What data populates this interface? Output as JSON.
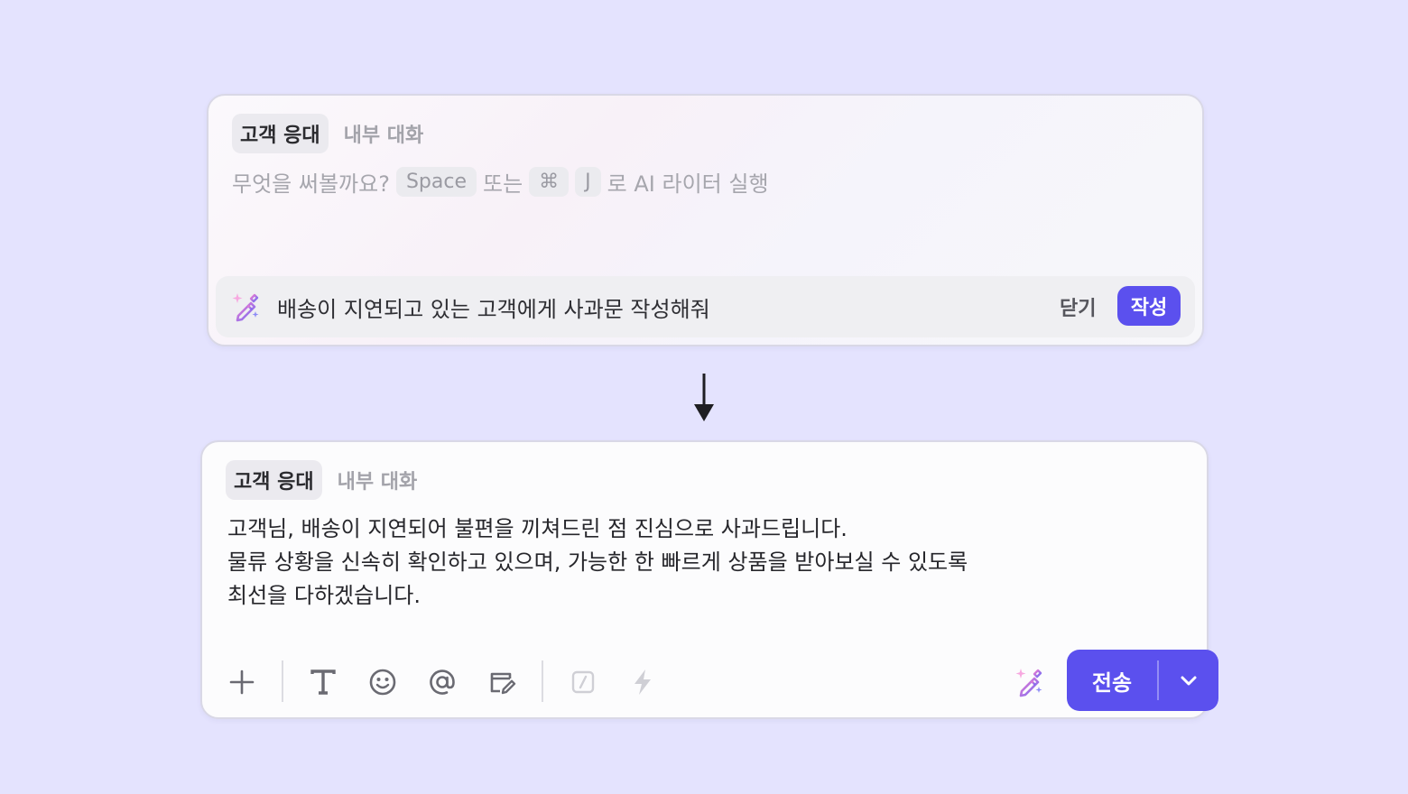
{
  "composer_ai_prompt": {
    "tabs": [
      {
        "label": "고객 응대",
        "active": true
      },
      {
        "label": "내부 대화",
        "active": false
      }
    ],
    "placeholder": {
      "prefix": "무엇을 써볼까요?",
      "key_space": "Space",
      "or_text": "또는",
      "key_cmd": "⌘",
      "key_j": "J",
      "suffix": "로 AI 라이터 실행"
    },
    "prompt_bar": {
      "icon": "magic-wand-icon",
      "text": "배송이 지연되고 있는 고객에게 사과문 작성해줘",
      "close_label": "닫기",
      "write_label": "작성"
    }
  },
  "transition": {
    "icon": "arrow-down-icon"
  },
  "composer_result": {
    "tabs": [
      {
        "label": "고객 응대",
        "active": true
      },
      {
        "label": "내부 대화",
        "active": false
      }
    ],
    "message_lines": [
      "고객님, 배송이 지연되어 불편을 끼쳐드린 점 진심으로 사과드립니다.",
      "물류 상황을 신속히 확인하고 있으며, 가능한 한 빠르게 상품을 받아보실 수 있도록",
      "최선을 다하겠습니다."
    ],
    "toolbar": {
      "icons": [
        "plus-icon",
        "text-format-icon",
        "emoji-icon",
        "mention-icon",
        "note-edit-icon",
        "slash-command-icon",
        "lightning-icon",
        "magic-wand-icon"
      ],
      "send_label": "전송",
      "dropdown_icon": "chevron-down-icon"
    }
  },
  "colors": {
    "background": "#e4e3fe",
    "accent": "#5b50ee"
  }
}
